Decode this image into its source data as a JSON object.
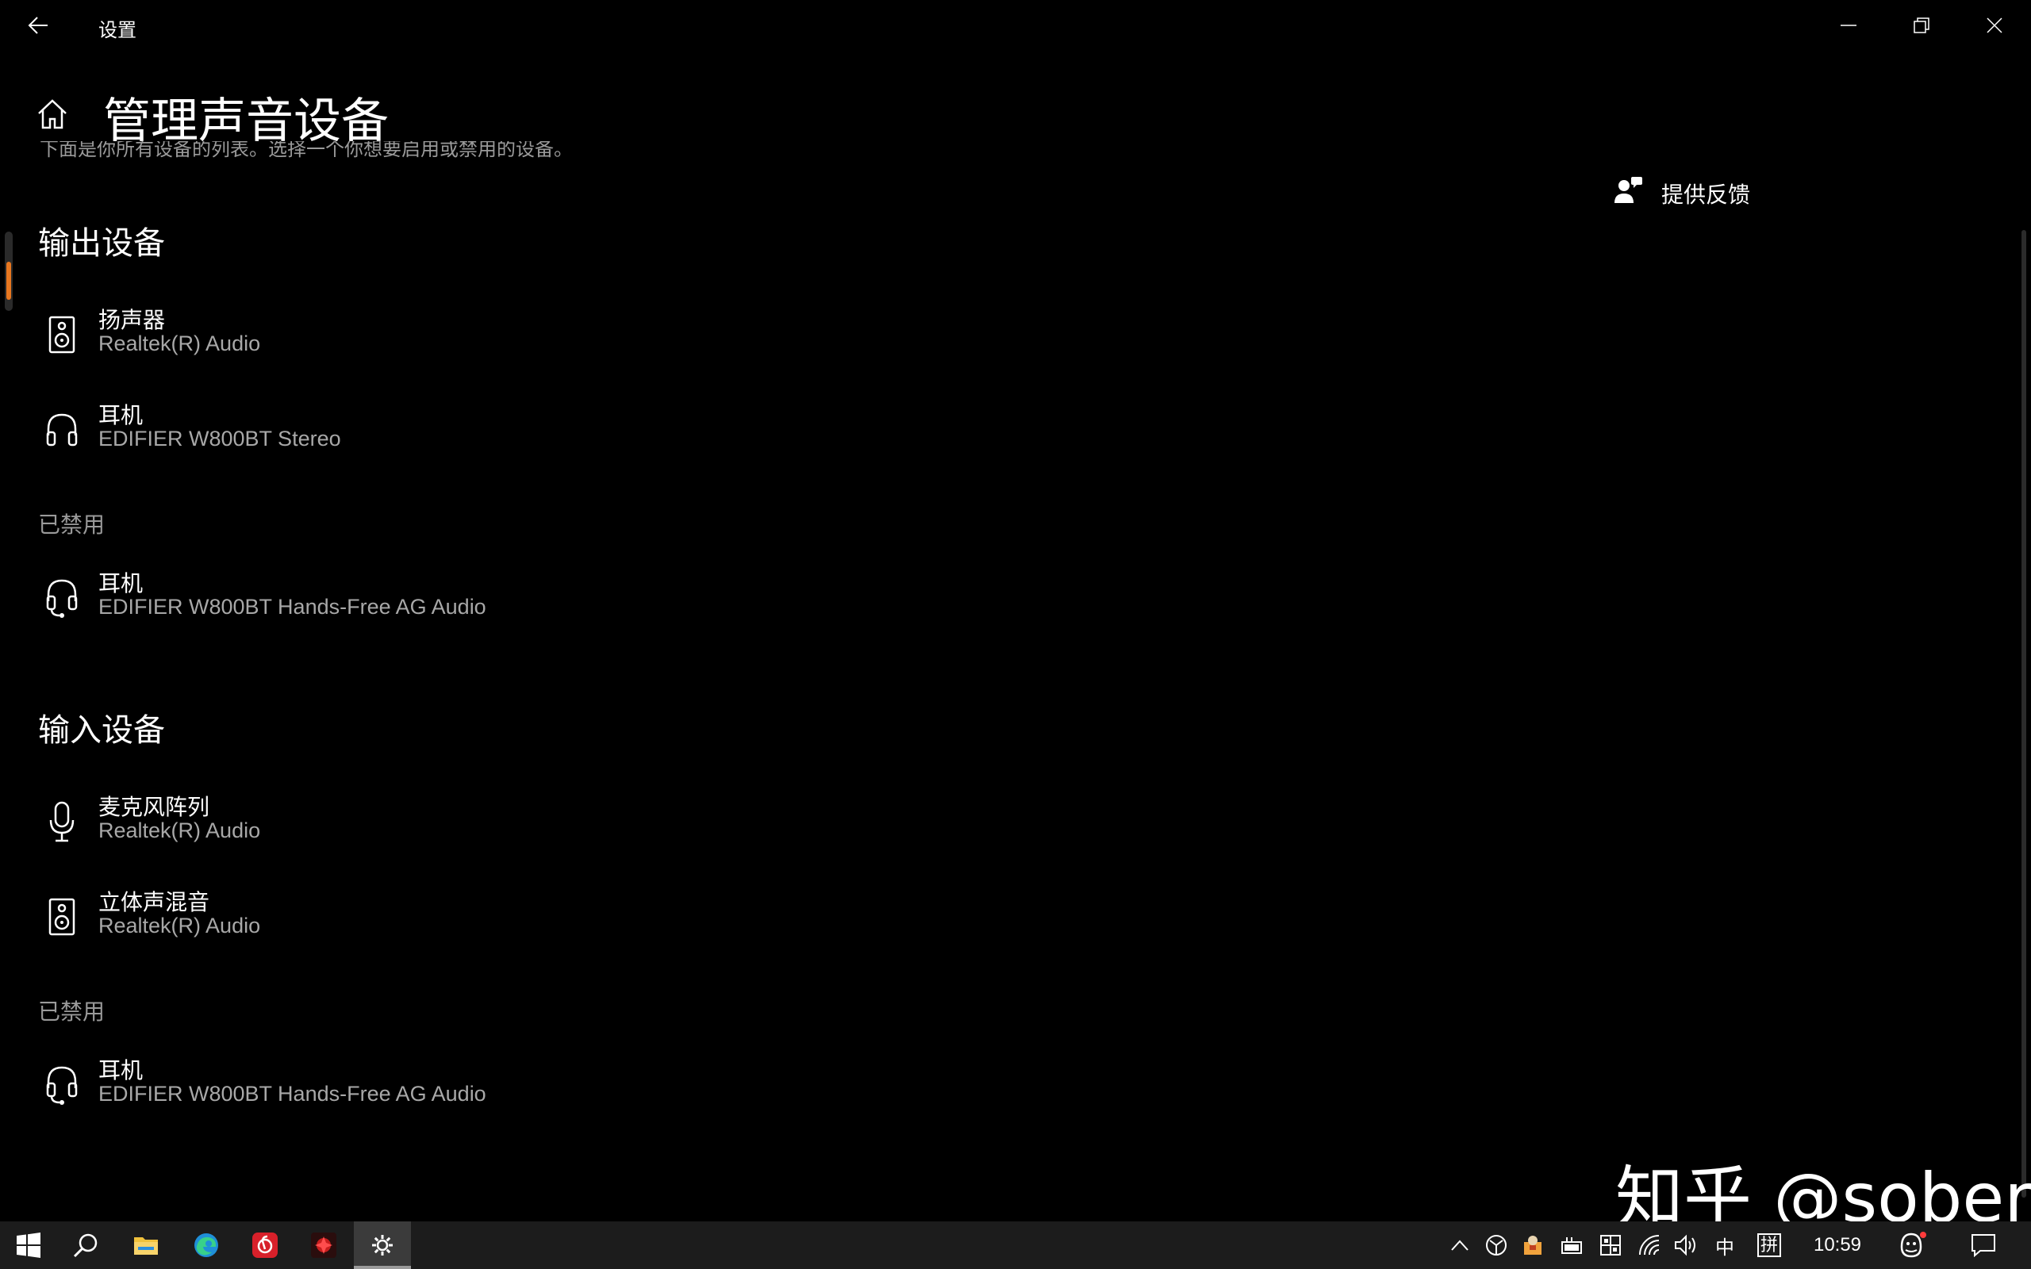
{
  "window": {
    "app_title": "设置",
    "back_icon": "arrow-left-icon",
    "controls": {
      "minimize_icon": "minimize-icon",
      "maximize_icon": "restore-icon",
      "close_icon": "close-icon"
    }
  },
  "header": {
    "title": "管理声音设备",
    "description": "下面是你所有设备的列表。选择一个你想要启用或禁用的设备。",
    "home_icon": "home-icon"
  },
  "feedback": {
    "label": "提供反馈",
    "icon": "feedback-person-icon"
  },
  "output": {
    "section_title": "输出设备",
    "devices": [
      {
        "name": "扬声器",
        "detail": "Realtek(R) Audio",
        "icon": "speaker-icon"
      },
      {
        "name": "耳机",
        "detail": "EDIFIER W800BT Stereo",
        "icon": "headphones-icon"
      }
    ],
    "disabled_label": "已禁用",
    "disabled_devices": [
      {
        "name": "耳机",
        "detail": "EDIFIER W800BT Hands-Free AG Audio",
        "icon": "headset-icon"
      }
    ]
  },
  "input": {
    "section_title": "输入设备",
    "devices": [
      {
        "name": "麦克风阵列",
        "detail": "Realtek(R) Audio",
        "icon": "microphone-icon"
      },
      {
        "name": "立体声混音",
        "detail": "Realtek(R) Audio",
        "icon": "speaker-icon"
      }
    ],
    "disabled_label": "已禁用",
    "disabled_devices": [
      {
        "name": "耳机",
        "detail": "EDIFIER W800BT Hands-Free AG Audio",
        "icon": "headset-icon"
      }
    ]
  },
  "watermark": "知乎 @sober",
  "taskbar": {
    "apps": [
      "start-icon",
      "search-icon",
      "file-explorer-icon",
      "edge-icon",
      "netease-music-icon",
      "game-app-icon",
      "settings-icon"
    ],
    "tray": {
      "input_mode": "中",
      "ime": "拼",
      "time": "10:59"
    }
  },
  "colors": {
    "background": "#000000",
    "accent": "#e8771f",
    "secondary_text": "#a8a8a8",
    "taskbar": "#1c1c1c"
  }
}
